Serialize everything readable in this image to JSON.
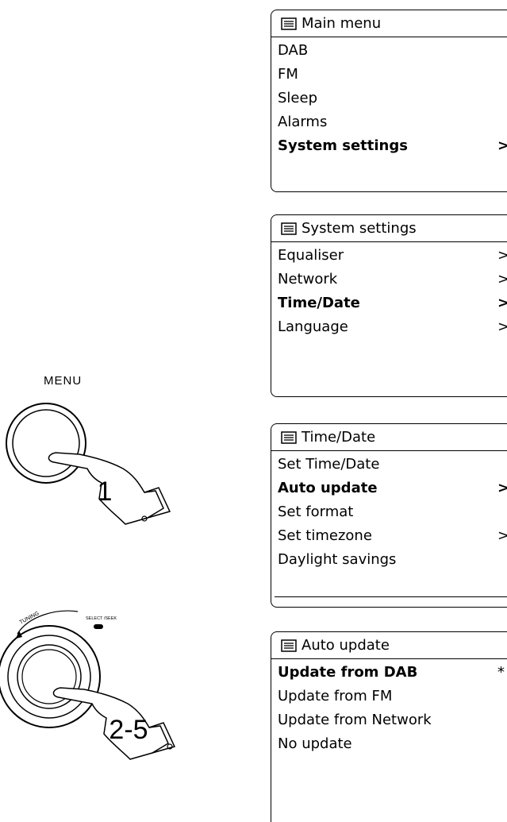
{
  "button_label": "MENU",
  "steps": {
    "menu_step": "1",
    "tuning_step": "2-5"
  },
  "knob_labels": {
    "tuning": "TUNING",
    "select": "SELECT /SEEK"
  },
  "screens": [
    {
      "title": "Main menu",
      "items": [
        {
          "label": "DAB",
          "suffix": ""
        },
        {
          "label": "FM",
          "suffix": ""
        },
        {
          "label": "Sleep",
          "suffix": ""
        },
        {
          "label": "Alarms",
          "suffix": ""
        },
        {
          "label": "System settings",
          "suffix": ">",
          "selected": true
        }
      ]
    },
    {
      "title": "System settings",
      "items": [
        {
          "label": "Equaliser",
          "suffix": ">"
        },
        {
          "label": "Network",
          "suffix": ">"
        },
        {
          "label": "Time/Date",
          "suffix": ">",
          "selected": true
        },
        {
          "label": "Language",
          "suffix": ">"
        }
      ]
    },
    {
      "title": "Time/Date",
      "items": [
        {
          "label": "Set Time/Date",
          "suffix": ""
        },
        {
          "label": "Auto update",
          "suffix": ">",
          "selected": true
        },
        {
          "label": "Set format",
          "suffix": ""
        },
        {
          "label": "Set timezone",
          "suffix": ">"
        },
        {
          "label": "Daylight savings",
          "suffix": ""
        }
      ]
    },
    {
      "title": "Auto update",
      "items": [
        {
          "label": "Update from DAB",
          "suffix": "*",
          "selected": true
        },
        {
          "label": "Update from FM",
          "suffix": ""
        },
        {
          "label": "Update from Network",
          "suffix": ""
        },
        {
          "label": "No update",
          "suffix": ""
        }
      ]
    }
  ],
  "icon": "list-icon"
}
